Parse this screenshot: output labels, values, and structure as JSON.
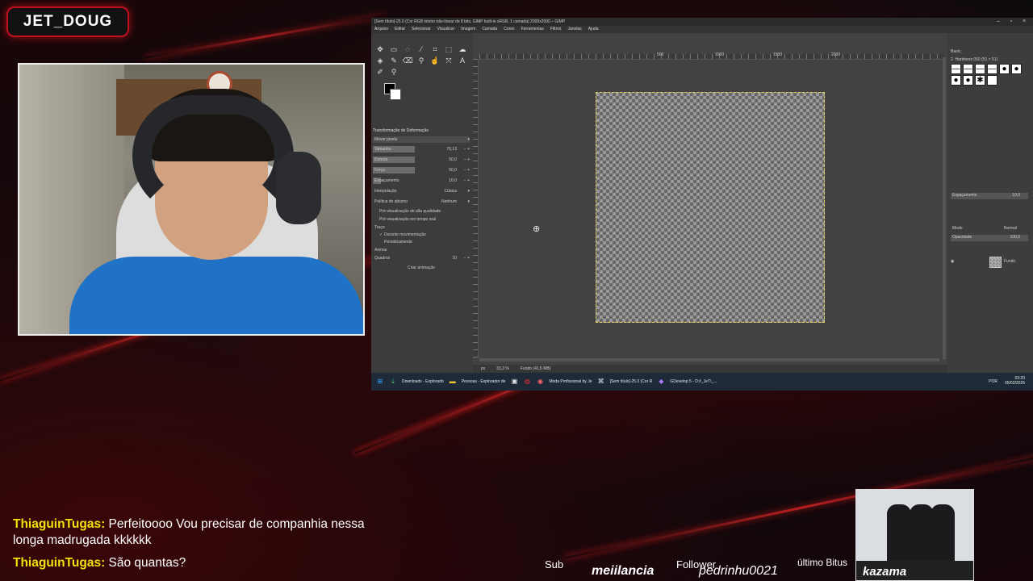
{
  "streamer_name": "JET_DOUG",
  "gimp": {
    "title": "[Sem título]-25.0 (Cor RGB inteiro não-linear de 8 bits, GIMP built-in sRGB, 1 camada) 2000x2000 – GIMP",
    "menu": [
      "Arquivo",
      "Editar",
      "Selecionar",
      "Visualizar",
      "Imagem",
      "Camada",
      "Cores",
      "Ferramentas",
      "Filtros",
      "Janelas",
      "Ajuda"
    ],
    "tool_options_title": "Transformação de Deformação",
    "mode_value": "Mover pixels",
    "options": [
      {
        "label": "Tamanho",
        "value": "76,13"
      },
      {
        "label": "Dureza",
        "value": "50,0"
      },
      {
        "label": "Força",
        "value": "50,0"
      },
      {
        "label": "Espaçamento",
        "value": "10,0"
      }
    ],
    "interpolation_label": "Interpolação",
    "interpolation_value": "Cúbica",
    "abyss_label": "Política de abismo",
    "abyss_value": "Nenhum",
    "hq_preview": "Pré-visualização de alta qualidade",
    "realtime_preview": "Pré-visualização em tempo real",
    "stroke_label": "Traço",
    "during_motion": "Durante movimentação",
    "periodically": "Periodicamente",
    "animate_label": "Animar",
    "frames_label": "Quadros",
    "frames_value": "10",
    "create_animation": "Criar animação",
    "ruler_marks": [
      "500",
      "1000",
      "1500",
      "2000"
    ],
    "status_unit": "px",
    "status_zoom": "33,3 %",
    "status_layer": "Fundo (41,5 MB)",
    "brush_set": "Basic,",
    "brush_name": "2. Hardness 050 (51 × 51)",
    "spacing_label": "Espaçamento",
    "spacing_value": "10,0",
    "mode_label": "Modo",
    "blend_mode": "Normal",
    "opacity_label": "Opacidade",
    "opacity_value": "100,0",
    "layer_name": "Fundo"
  },
  "taskbar": {
    "items": [
      "Downloads - Explorado",
      "Pessoas - Explorador de",
      "Moda Profissional by Je",
      "[Sem título]-25.0 (Cor R",
      "GDevelop 5 - D:/\\_JeT\\_..."
    ],
    "lang": "POR",
    "time": "03:20",
    "date": "05/02/2026"
  },
  "chat": [
    {
      "user": "ThiaguinTugas",
      "message": "Perfeitoooo Vou precisar de companhia nessa longa madrugada kkkkkk"
    },
    {
      "user": "ThiaguinTugas",
      "message": "São quantas?"
    }
  ],
  "bottom": {
    "sub_label": "Sub",
    "sub_name": "meiilancia",
    "follower_label": "Follower",
    "follower_name": "pedrinhu0021",
    "bits_label": "último Bitus",
    "bits_name": "kazama"
  },
  "colors": {
    "accent_red": "#c01020",
    "chat_user": "#f5e10a",
    "taskbar_bg": "#1e2a38"
  }
}
